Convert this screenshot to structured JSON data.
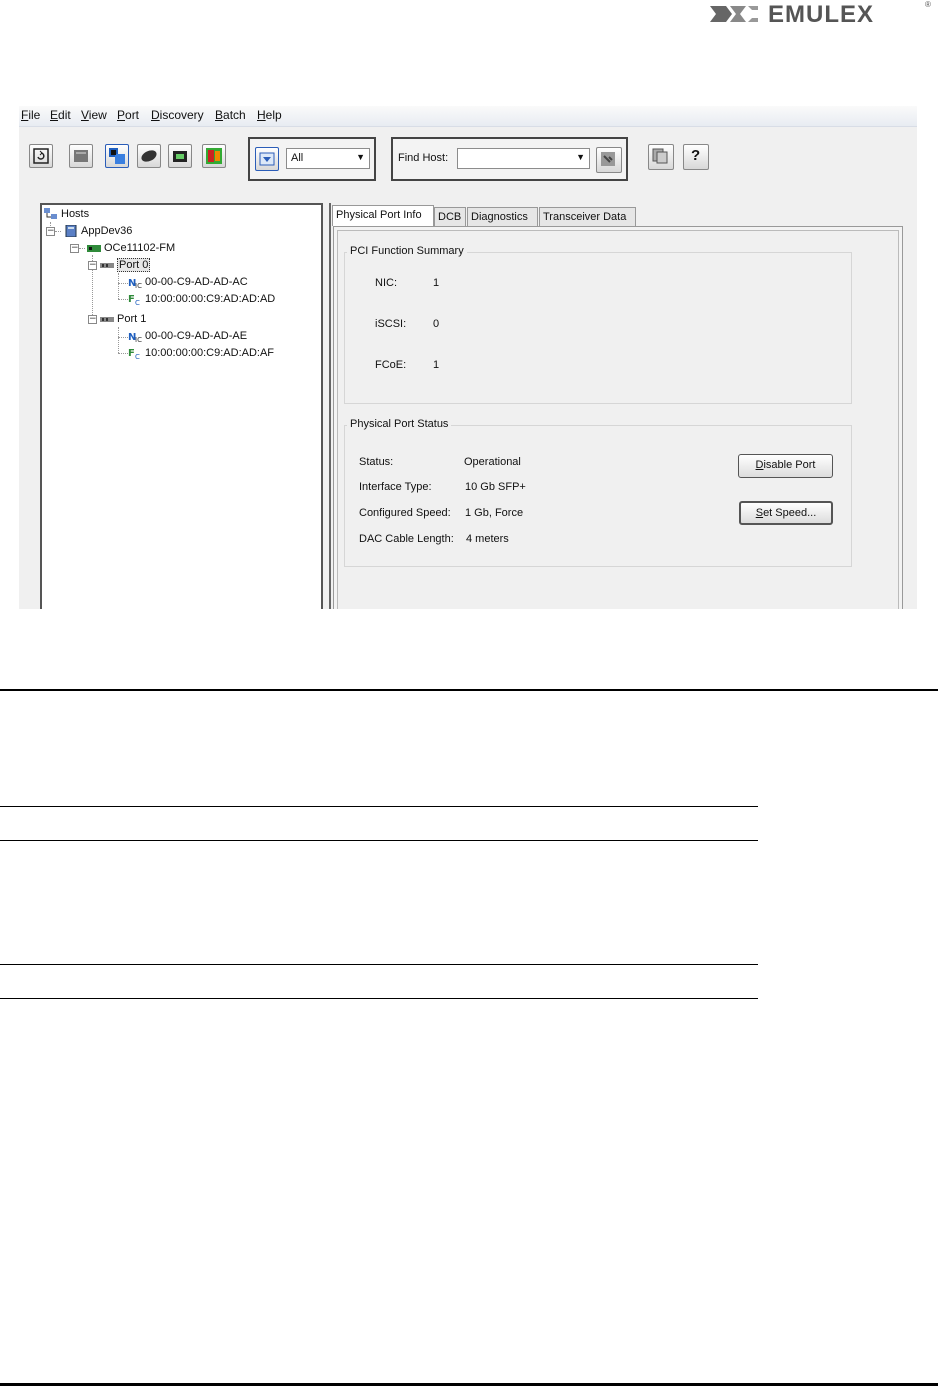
{
  "logo": {
    "text": "EMULEX",
    "reg": "®"
  },
  "menu": [
    "File",
    "Edit",
    "View",
    "Port",
    "Discovery",
    "Batch",
    "Help"
  ],
  "toolbar": {
    "filter_value": "All",
    "find_host_label": "Find Host:",
    "find_host_value": "",
    "help_glyph": "?"
  },
  "tree": {
    "root": "Hosts",
    "host": "AppDev36",
    "adapter": "OCe11102-FM",
    "port0": "Port 0",
    "port0_nic": "00-00-C9-AD-AD-AC",
    "port0_fcoe": "10:00:00:00:C9:AD:AD:AD",
    "port1": "Port 1",
    "port1_nic": "00-00-C9-AD-AD-AE",
    "port1_fcoe": "10:00:00:00:C9:AD:AD:AF"
  },
  "tabs": [
    "Physical Port Info",
    "DCB",
    "Diagnostics",
    "Transceiver Data"
  ],
  "pci_summary": {
    "title": "PCI Function Summary",
    "rows": [
      {
        "label": "NIC:",
        "value": "1"
      },
      {
        "label": "iSCSI:",
        "value": "0"
      },
      {
        "label": "FCoE:",
        "value": "1"
      }
    ]
  },
  "port_status": {
    "title": "Physical Port Status",
    "rows": [
      {
        "label": "Status:",
        "value": "Operational"
      },
      {
        "label": "Interface Type:",
        "value": "10 Gb SFP+"
      },
      {
        "label": "Configured Speed:",
        "value": "1 Gb, Force"
      },
      {
        "label": "DAC Cable Length:",
        "value": "4 meters"
      }
    ],
    "disable_button": "Disable Port",
    "speed_button": "Set Speed..."
  },
  "colors": {
    "accent_blue": "#1f5fbf",
    "fc_green": "#2f8a3a",
    "rule": "#000000"
  }
}
